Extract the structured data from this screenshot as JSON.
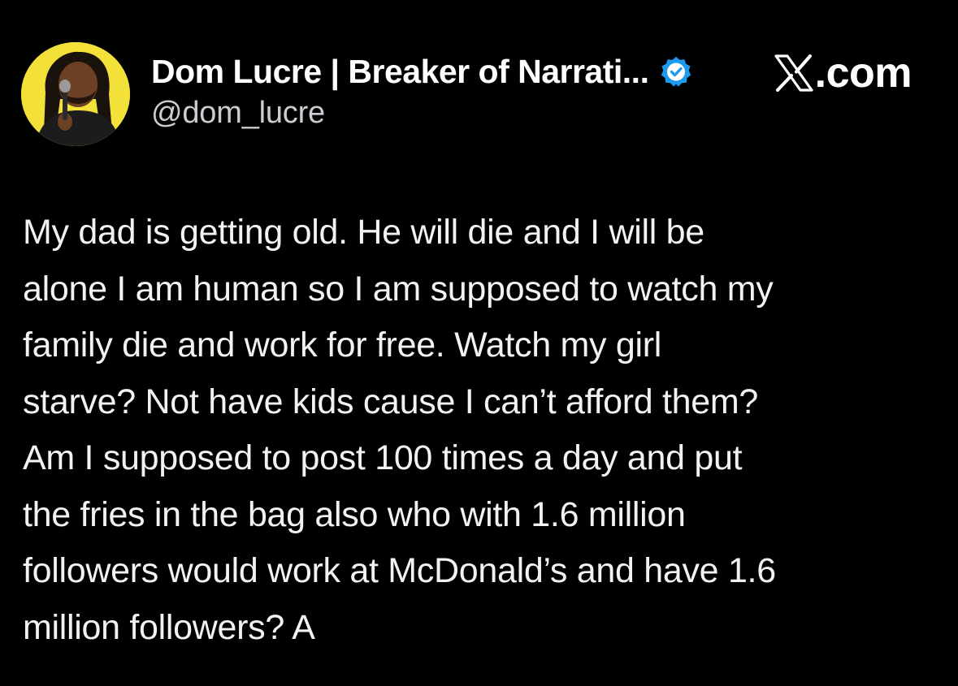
{
  "author": {
    "display_name": "Dom Lucre | Breaker of Narrati...",
    "handle": "@dom_lucre",
    "verified": true,
    "avatar_bg": "#f3e13a"
  },
  "brand": {
    "icon": "x-logo-icon",
    "text": ".com"
  },
  "tweet": {
    "text": "My dad is getting old. He will die and I will be\nalone I am human so I am supposed to watch my\nfamily die and work for free. Watch my girl\nstarve? Not have kids cause I can’t afford them?\nAm I supposed to post 100 times a day and put\nthe fries in the bag also who with 1.6 million\nfollowers would work at McDonald’s and have 1.6\nmillion followers? A"
  },
  "colors": {
    "background": "#000000",
    "text": "#f2f2f2",
    "secondary_text": "#c9ccd0",
    "verified_blue": "#1d9bf0"
  }
}
